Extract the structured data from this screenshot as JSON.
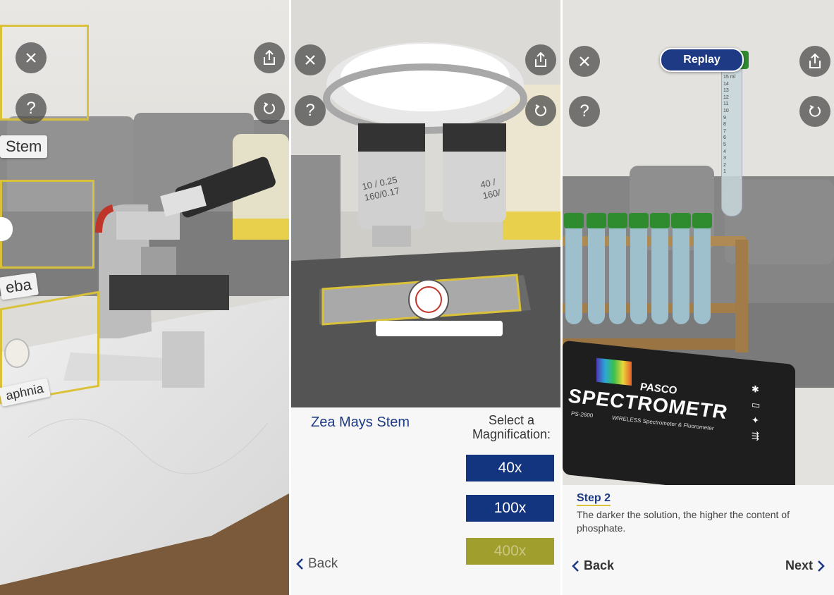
{
  "panel1": {
    "labels": [
      "Stem",
      "eba",
      "aphnia"
    ]
  },
  "panel2": {
    "objective_left": [
      "10 / 0.25",
      "160/0.17"
    ],
    "objective_right": [
      "40 /",
      "160/"
    ],
    "specimen_title": "Zea Mays Stem",
    "select_prompt": [
      "Select a",
      "Magnification:"
    ],
    "magnifications": [
      "40x",
      "100x",
      "400x"
    ],
    "back_label": "Back",
    "colors": {
      "button_blue": "#13347e",
      "button_disabled": "#a09f2e",
      "title_blue": "#1f3a84"
    }
  },
  "panel3": {
    "replay_label": "Replay",
    "tube_scale": [
      "15 ml",
      "14",
      "13",
      "12",
      "11",
      "10",
      "9",
      "8",
      "7",
      "6",
      "5",
      "4",
      "3",
      "2",
      "1"
    ],
    "device_brand": "PASCO",
    "device_name": "SPECTROMETR",
    "device_model": "PS-2600",
    "device_subtitle": "WIRELESS Spectrometer & Fluorometer",
    "step_title": "Step 2",
    "step_text": "The darker the solution, the higher the content of phosphate.",
    "back_label": "Back",
    "next_label": "Next",
    "colors": {
      "step_blue": "#1f3a84",
      "cap_green": "#2e8b2e"
    }
  },
  "icons": [
    "close-icon",
    "help-icon",
    "share-icon",
    "reset-icon",
    "chevron-left-icon",
    "chevron-right-icon"
  ]
}
